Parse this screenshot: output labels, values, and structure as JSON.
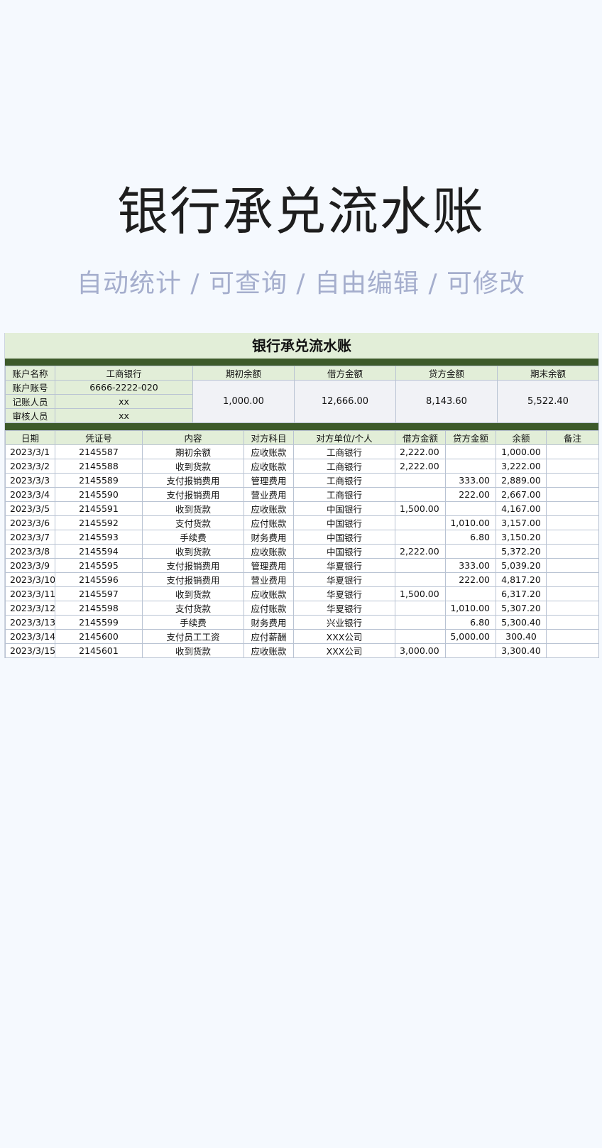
{
  "hero": {
    "title": "银行承兑流水账",
    "subtitle": "自动统计 / 可查询 / 自由编辑 / 可修改"
  },
  "sheet": {
    "title": "银行承兑流水账",
    "info": {
      "account_name_label": "账户名称",
      "account_name": "工商银行",
      "account_no_label": "账户账号",
      "account_no": "6666-2222-020",
      "recorder_label": "记账人员",
      "recorder": "xx",
      "reviewer_label": "审核人员",
      "reviewer": "xx",
      "opening_label": "期初余额",
      "opening": "1,000.00",
      "debit_label": "借方金额",
      "debit": "12,666.00",
      "credit_label": "贷方金额",
      "credit": "8,143.60",
      "closing_label": "期末余额",
      "closing": "5,522.40"
    },
    "columns": [
      "日期",
      "凭证号",
      "内容",
      "对方科目",
      "对方单位/个人",
      "借方金额",
      "贷方金额",
      "余额",
      "备注"
    ],
    "rows": [
      [
        "2023/3/1",
        "2145587",
        "期初余额",
        "应收账款",
        "工商银行",
        "2,222.00",
        "",
        "1,000.00",
        ""
      ],
      [
        "2023/3/2",
        "2145588",
        "收到货款",
        "应收账款",
        "工商银行",
        "2,222.00",
        "",
        "3,222.00",
        ""
      ],
      [
        "2023/3/3",
        "2145589",
        "支付报销费用",
        "管理费用",
        "工商银行",
        "",
        "333.00",
        "2,889.00",
        ""
      ],
      [
        "2023/3/4",
        "2145590",
        "支付报销费用",
        "营业费用",
        "工商银行",
        "",
        "222.00",
        "2,667.00",
        ""
      ],
      [
        "2023/3/5",
        "2145591",
        "收到货款",
        "应收账款",
        "中国银行",
        "1,500.00",
        "",
        "4,167.00",
        ""
      ],
      [
        "2023/3/6",
        "2145592",
        "支付货款",
        "应付账款",
        "中国银行",
        "",
        "1,010.00",
        "3,157.00",
        ""
      ],
      [
        "2023/3/7",
        "2145593",
        "手续费",
        "财务费用",
        "中国银行",
        "",
        "6.80",
        "3,150.20",
        ""
      ],
      [
        "2023/3/8",
        "2145594",
        "收到货款",
        "应收账款",
        "中国银行",
        "2,222.00",
        "",
        "5,372.20",
        ""
      ],
      [
        "2023/3/9",
        "2145595",
        "支付报销费用",
        "管理费用",
        "华夏银行",
        "",
        "333.00",
        "5,039.20",
        ""
      ],
      [
        "2023/3/10",
        "2145596",
        "支付报销费用",
        "营业费用",
        "华夏银行",
        "",
        "222.00",
        "4,817.20",
        ""
      ],
      [
        "2023/3/11",
        "2145597",
        "收到货款",
        "应收账款",
        "华夏银行",
        "1,500.00",
        "",
        "6,317.20",
        ""
      ],
      [
        "2023/3/12",
        "2145598",
        "支付货款",
        "应付账款",
        "华夏银行",
        "",
        "1,010.00",
        "5,307.20",
        ""
      ],
      [
        "2023/3/13",
        "2145599",
        "手续费",
        "财务费用",
        "兴业银行",
        "",
        "6.80",
        "5,300.40",
        ""
      ],
      [
        "2023/3/14",
        "2145600",
        "支付员工工资",
        "应付薪酬",
        "XXX公司",
        "",
        "5,000.00",
        "300.40",
        ""
      ],
      [
        "2023/3/15",
        "2145601",
        "收到货款",
        "应收账款",
        "XXX公司",
        "3,000.00",
        "",
        "3,300.40",
        ""
      ]
    ]
  },
  "colors": {
    "header_green": "#e2eed8",
    "dark_green": "#3d5a2a",
    "subtitle": "#a5aecd",
    "background": "#f5f9fe"
  }
}
